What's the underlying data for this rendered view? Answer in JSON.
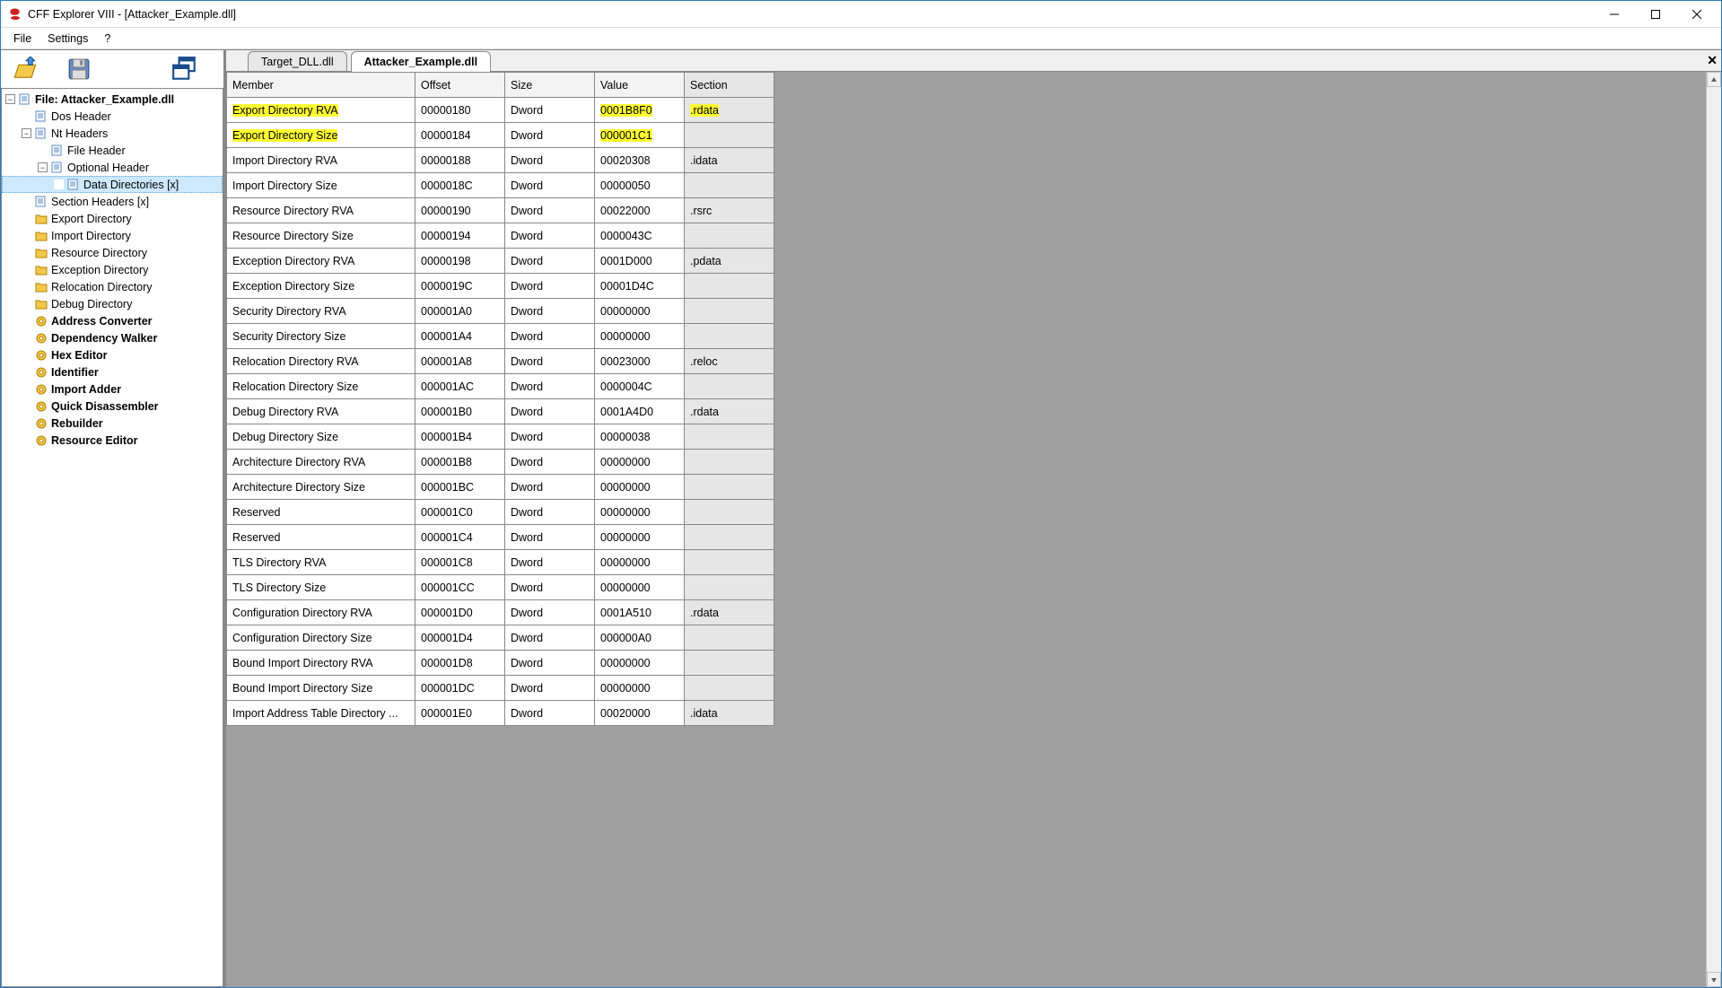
{
  "window": {
    "title": "CFF Explorer VIII - [Attacker_Example.dll]"
  },
  "menu": {
    "file": "File",
    "settings": "Settings",
    "help": "?"
  },
  "tabs": {
    "inactive": "Target_DLL.dll",
    "active": "Attacker_Example.dll"
  },
  "tree": {
    "root": "File: Attacker_Example.dll",
    "dos": "Dos Header",
    "nt": "Nt Headers",
    "file_h": "File Header",
    "opt": "Optional Header",
    "data_dirs": "Data Directories [x]",
    "sec_h": "Section Headers [x]",
    "export_dir": "Export Directory",
    "import_dir": "Import Directory",
    "resource_dir": "Resource Directory",
    "exception_dir": "Exception Directory",
    "reloc_dir": "Relocation Directory",
    "debug_dir": "Debug Directory",
    "addr_conv": "Address Converter",
    "dep_walker": "Dependency Walker",
    "hex_editor": "Hex Editor",
    "identifier": "Identifier",
    "import_adder": "Import Adder",
    "quick_disasm": "Quick Disassembler",
    "rebuilder": "Rebuilder",
    "res_editor": "Resource Editor"
  },
  "table": {
    "headers": {
      "member": "Member",
      "offset": "Offset",
      "size": "Size",
      "value": "Value",
      "section": "Section"
    },
    "rows": [
      {
        "member": "Export Directory RVA",
        "offset": "00000180",
        "size": "Dword",
        "value": "0001B8F0",
        "section": ".rdata",
        "hl": true
      },
      {
        "member": "Export Directory Size",
        "offset": "00000184",
        "size": "Dword",
        "value": "000001C1",
        "section": "",
        "hl": true
      },
      {
        "member": "Import Directory RVA",
        "offset": "00000188",
        "size": "Dword",
        "value": "00020308",
        "section": ".idata"
      },
      {
        "member": "Import Directory Size",
        "offset": "0000018C",
        "size": "Dword",
        "value": "00000050",
        "section": ""
      },
      {
        "member": "Resource Directory RVA",
        "offset": "00000190",
        "size": "Dword",
        "value": "00022000",
        "section": ".rsrc"
      },
      {
        "member": "Resource Directory Size",
        "offset": "00000194",
        "size": "Dword",
        "value": "0000043C",
        "section": ""
      },
      {
        "member": "Exception Directory RVA",
        "offset": "00000198",
        "size": "Dword",
        "value": "0001D000",
        "section": ".pdata"
      },
      {
        "member": "Exception Directory Size",
        "offset": "0000019C",
        "size": "Dword",
        "value": "00001D4C",
        "section": ""
      },
      {
        "member": "Security Directory RVA",
        "offset": "000001A0",
        "size": "Dword",
        "value": "00000000",
        "section": ""
      },
      {
        "member": "Security Directory Size",
        "offset": "000001A4",
        "size": "Dword",
        "value": "00000000",
        "section": ""
      },
      {
        "member": "Relocation Directory RVA",
        "offset": "000001A8",
        "size": "Dword",
        "value": "00023000",
        "section": ".reloc"
      },
      {
        "member": "Relocation Directory Size",
        "offset": "000001AC",
        "size": "Dword",
        "value": "0000004C",
        "section": ""
      },
      {
        "member": "Debug Directory RVA",
        "offset": "000001B0",
        "size": "Dword",
        "value": "0001A4D0",
        "section": ".rdata"
      },
      {
        "member": "Debug Directory Size",
        "offset": "000001B4",
        "size": "Dword",
        "value": "00000038",
        "section": ""
      },
      {
        "member": "Architecture Directory RVA",
        "offset": "000001B8",
        "size": "Dword",
        "value": "00000000",
        "section": ""
      },
      {
        "member": "Architecture Directory Size",
        "offset": "000001BC",
        "size": "Dword",
        "value": "00000000",
        "section": ""
      },
      {
        "member": "Reserved",
        "offset": "000001C0",
        "size": "Dword",
        "value": "00000000",
        "section": ""
      },
      {
        "member": "Reserved",
        "offset": "000001C4",
        "size": "Dword",
        "value": "00000000",
        "section": ""
      },
      {
        "member": "TLS Directory RVA",
        "offset": "000001C8",
        "size": "Dword",
        "value": "00000000",
        "section": ""
      },
      {
        "member": "TLS Directory Size",
        "offset": "000001CC",
        "size": "Dword",
        "value": "00000000",
        "section": ""
      },
      {
        "member": "Configuration Directory RVA",
        "offset": "000001D0",
        "size": "Dword",
        "value": "0001A510",
        "section": ".rdata"
      },
      {
        "member": "Configuration Directory Size",
        "offset": "000001D4",
        "size": "Dword",
        "value": "000000A0",
        "section": ""
      },
      {
        "member": "Bound Import Directory RVA",
        "offset": "000001D8",
        "size": "Dword",
        "value": "00000000",
        "section": ""
      },
      {
        "member": "Bound Import Directory Size",
        "offset": "000001DC",
        "size": "Dword",
        "value": "00000000",
        "section": ""
      },
      {
        "member": "Import Address Table Directory ...",
        "offset": "000001E0",
        "size": "Dword",
        "value": "00020000",
        "section": ".idata"
      }
    ]
  }
}
